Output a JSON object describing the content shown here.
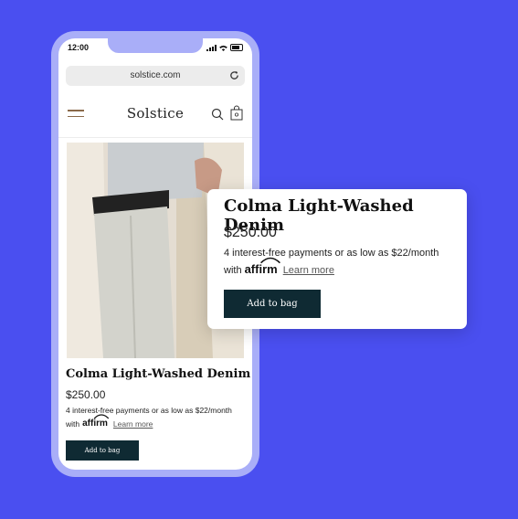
{
  "status": {
    "time": "12:00"
  },
  "browser": {
    "url": "solstice.com"
  },
  "site": {
    "brand": "Solstice"
  },
  "product": {
    "title": "Colma Light-Washed Denim",
    "price": "$250.00",
    "payment_text": "4 interest-free payments or as low as $22/month",
    "with_text": "with",
    "affirm_logo": "affirm",
    "learn_more": "Learn more",
    "add_to_bag": "Add to bag"
  },
  "popup": {
    "title": "Colma Light-Washed Denim",
    "price": "$250.00",
    "payment_text": "4 interest-free payments or as low as $22/month",
    "with_text": "with",
    "affirm_logo": "affirm",
    "learn_more": "Learn more",
    "add_to_bag": "Add to bag"
  },
  "colors": {
    "background": "#4a4ff0",
    "phone_frame": "#a9aef8",
    "button": "#0f2a33"
  }
}
